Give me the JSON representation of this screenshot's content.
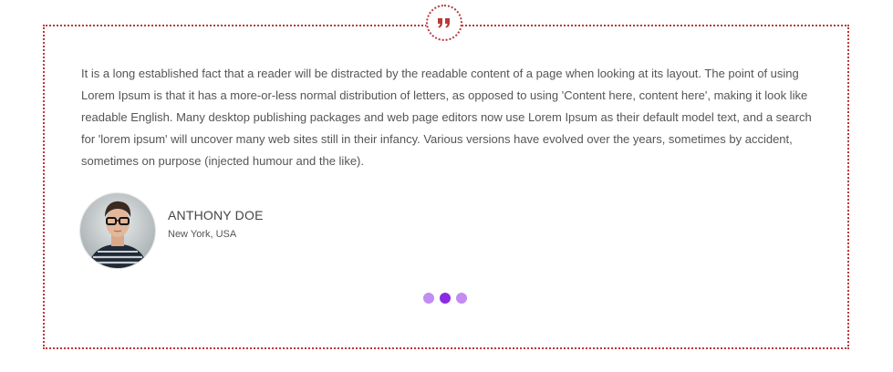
{
  "testimonial": {
    "quote_icon": "quote-icon",
    "text": "It is a long established fact that a reader will be distracted by the readable content of a page when looking at its layout. The point of using Lorem Ipsum is that it has a more-or-less normal distribution of letters, as opposed to using 'Content here, content here', making it look like readable English. Many desktop publishing packages and web page editors now use Lorem Ipsum as their default model text, and a search for 'lorem ipsum' will uncover many web sites still in their infancy. Various versions have evolved over the years, sometimes by accident, sometimes on purpose (injected humour and the like).",
    "author": {
      "name": "ANTHONY DOE",
      "location": "New York, USA"
    }
  },
  "carousel": {
    "slide_count": 3,
    "active_index": 1
  },
  "colors": {
    "border": "#b8393c",
    "dot_inactive": "#c28cf2",
    "dot_active": "#8a2be2"
  }
}
